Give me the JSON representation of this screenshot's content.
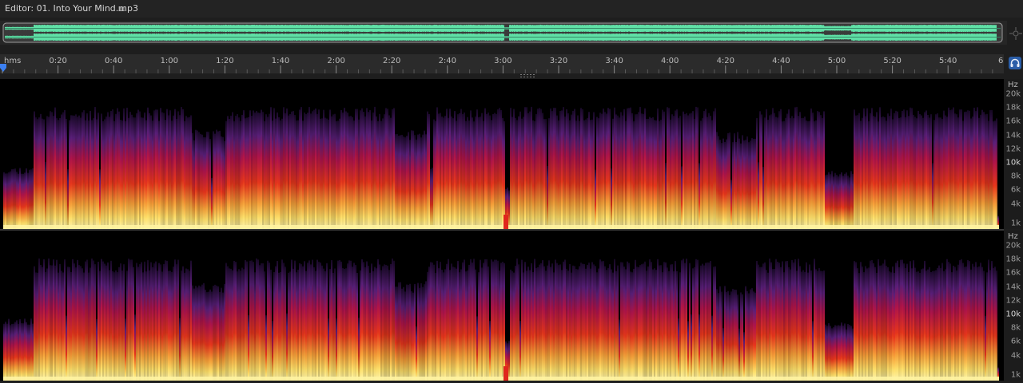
{
  "editor": {
    "title": "Editor: 01. Into Your Mind.mp3",
    "menu_icon": "hamburger-menu-icon"
  },
  "timeline": {
    "unit_label": "hms",
    "labels": [
      "0:20",
      "0:40",
      "1:00",
      "1:20",
      "1:40",
      "2:00",
      "2:20",
      "2:40",
      "3:00",
      "3:20",
      "3:40",
      "4:00",
      "4:20",
      "4:40",
      "5:00",
      "5:20",
      "5:40",
      "6"
    ]
  },
  "frequency_scale": {
    "unit": "Hz",
    "labels": [
      "20k",
      "18k",
      "16k",
      "14k",
      "12k",
      "10k",
      "8k",
      "6k",
      "4k",
      "1k"
    ],
    "major_label": "10k"
  },
  "colors": {
    "waveform": "#5fe0a6",
    "spectrogram_low": "#ffe06a",
    "spectrogram_mid": "#e8361c",
    "spectrogram_high": "#5a1f7a",
    "background": "#000000",
    "accent": "#2b5ea8"
  },
  "icons": {
    "playhead": "playhead-marker-icon",
    "headphones": "headphones-icon",
    "zoom_navigator": "zoom-navigator-icon"
  }
}
